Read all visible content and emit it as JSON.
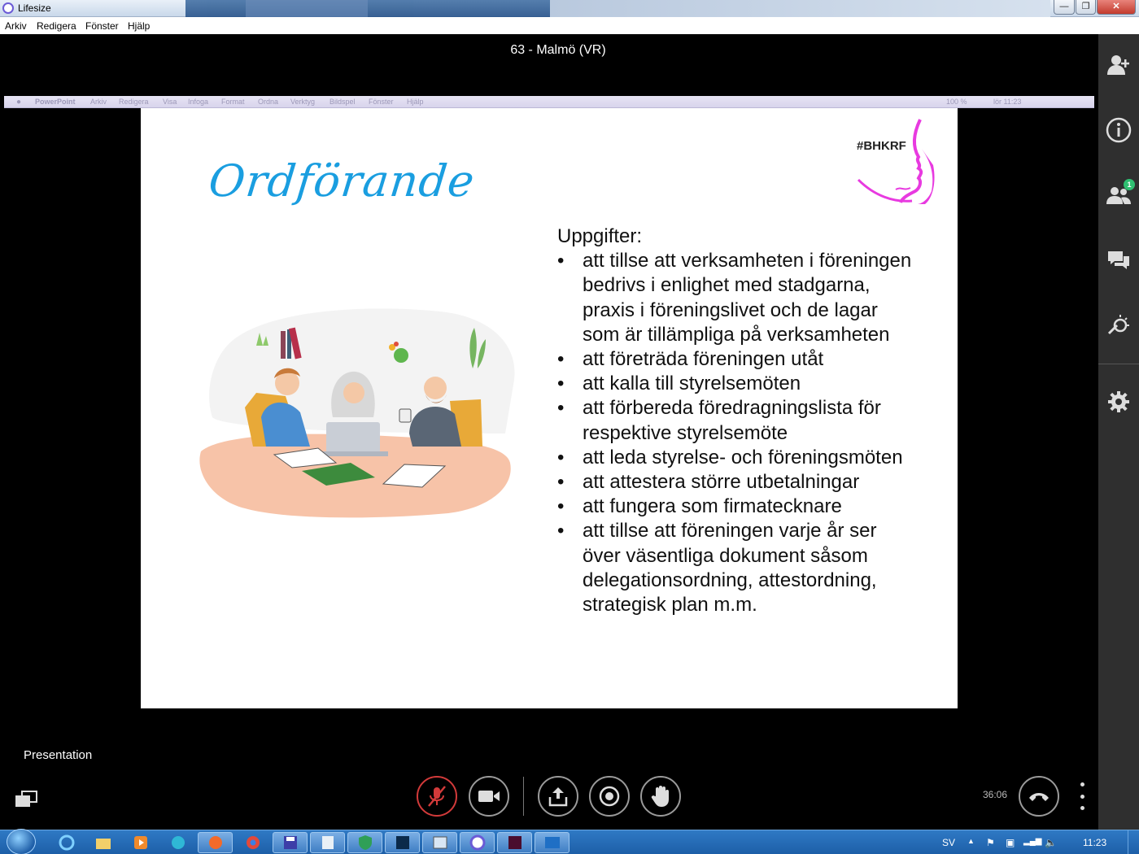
{
  "window": {
    "title": "Lifesize",
    "controls": [
      "minimize",
      "maximize",
      "close"
    ]
  },
  "menubar": {
    "items": [
      "Arkiv",
      "Redigera",
      "Fönster",
      "Hjälp"
    ]
  },
  "meeting": {
    "title": "63 - Malmö (VR)"
  },
  "shared_screen": {
    "mac_menu": [
      "PowerPoint",
      "Arkiv",
      "Redigera",
      "Visa",
      "Infoga",
      "Format",
      "Ordna",
      "Verktyg",
      "Bildspel",
      "Fönster",
      "Hjälp"
    ],
    "mac_status": {
      "battery": "100 %",
      "clock": "lör 11:23"
    },
    "slide": {
      "title": "Ordförande",
      "hashtag": "#BHKRF",
      "heading": "Uppgifter:",
      "bullets": [
        "att tillse att verksamheten i föreningen bedrivs i enlighet med stadgarna, praxis i föreningslivet och de lagar som är tillämpliga på verksamheten",
        "att företräda föreningen utåt",
        "att kalla till styrelsemöten",
        "att förbereda föredragningslista för respektive styrelsemöte",
        "att leda styrelse- och föreningsmöten",
        "att attestera större utbetalningar",
        "att fungera som firmatecknare",
        "att tillse att föreningen varje år ser över väsentliga dokument såsom delegationsordning, attestordning, strategisk plan m.m."
      ]
    }
  },
  "rail": {
    "participants_badge": "1",
    "icons": [
      "add-participant-icon",
      "info-icon",
      "participants-icon",
      "chat-icon",
      "whiteboard-icon",
      "settings-icon"
    ]
  },
  "bottom": {
    "presentation_label": "Presentation",
    "timer": "36:06"
  },
  "taskbar": {
    "language": "SV",
    "clock": "11:23"
  }
}
